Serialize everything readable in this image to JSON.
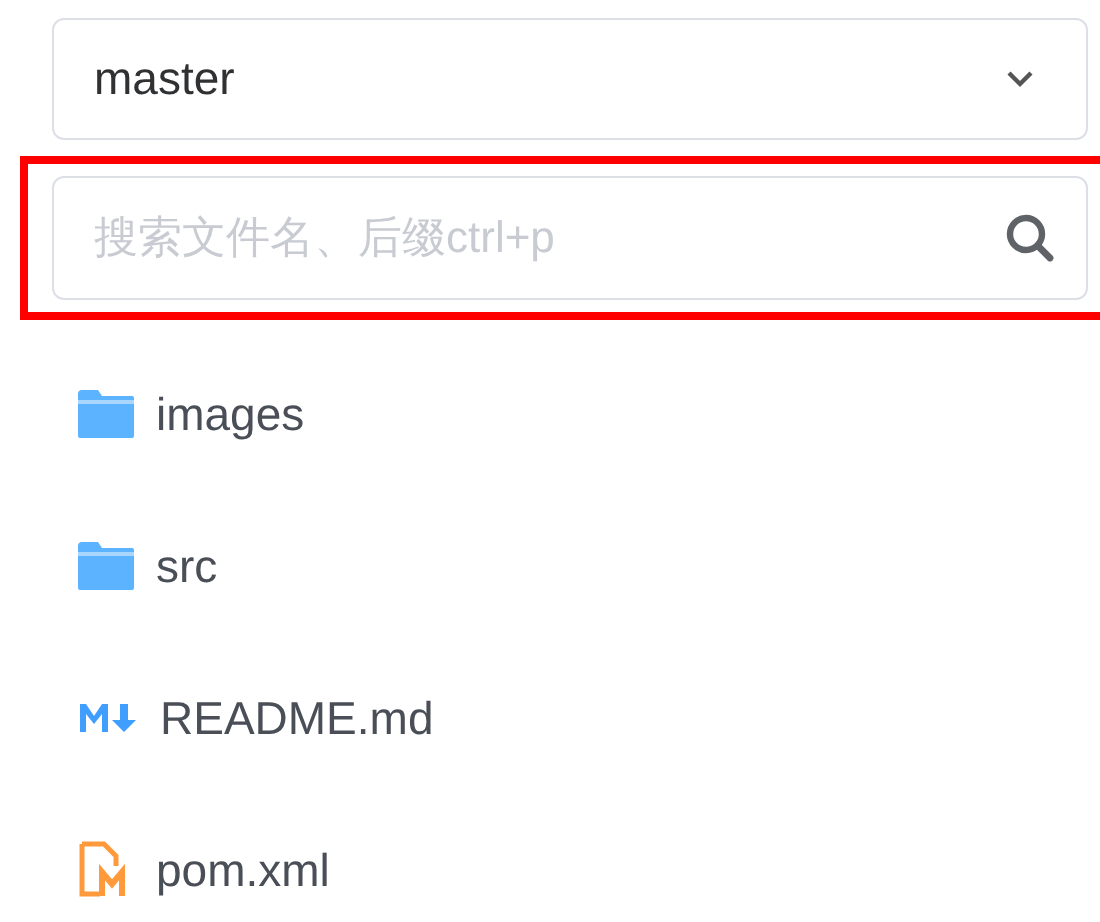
{
  "branch_select": {
    "value": "master"
  },
  "search": {
    "placeholder": "搜索文件名、后缀ctrl+p",
    "highlighted": true
  },
  "files": [
    {
      "kind": "folder",
      "name": "images"
    },
    {
      "kind": "folder",
      "name": "src"
    },
    {
      "kind": "markdown",
      "name": "README.md"
    },
    {
      "kind": "maven",
      "name": "pom.xml"
    }
  ]
}
